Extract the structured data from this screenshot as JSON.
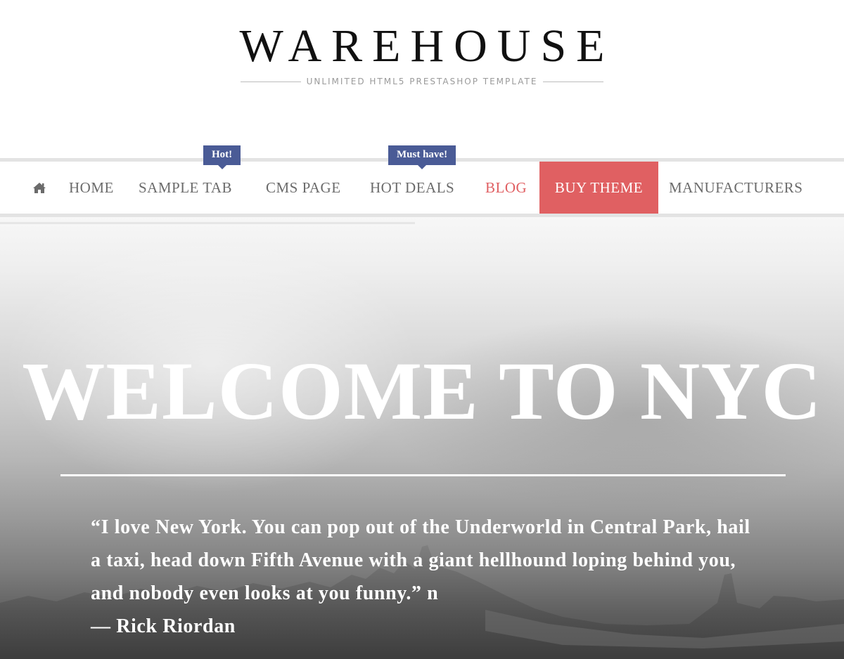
{
  "logo": {
    "title": "WAREHOUSE",
    "tagline": "UNLIMITED HTML5 PRESTASHOP TEMPLATE"
  },
  "nav": {
    "home_icon": "home-icon",
    "items": [
      {
        "label": "HOME"
      },
      {
        "label": "SAMPLE TAB",
        "badge": "Hot!"
      },
      {
        "label": "CMS PAGE"
      },
      {
        "label": "HOT DEALS",
        "badge": "Must have!"
      },
      {
        "label": "BLOG",
        "color": "#e05f62"
      },
      {
        "label": "BUY THEME",
        "background": "#e06062",
        "color": "#ffffff"
      },
      {
        "label": "MANUFACTURERS"
      }
    ],
    "badge_color": "#4a5b96"
  },
  "hero": {
    "title": "WELCOME TO NYC",
    "quote": "“I love New York. You can pop out of the Underworld in Central Park, hail a taxi, head down Fifth Avenue with a giant hellhound loping behind you, and nobody even looks at you funny.” n",
    "author": "— Rick Riordan"
  }
}
